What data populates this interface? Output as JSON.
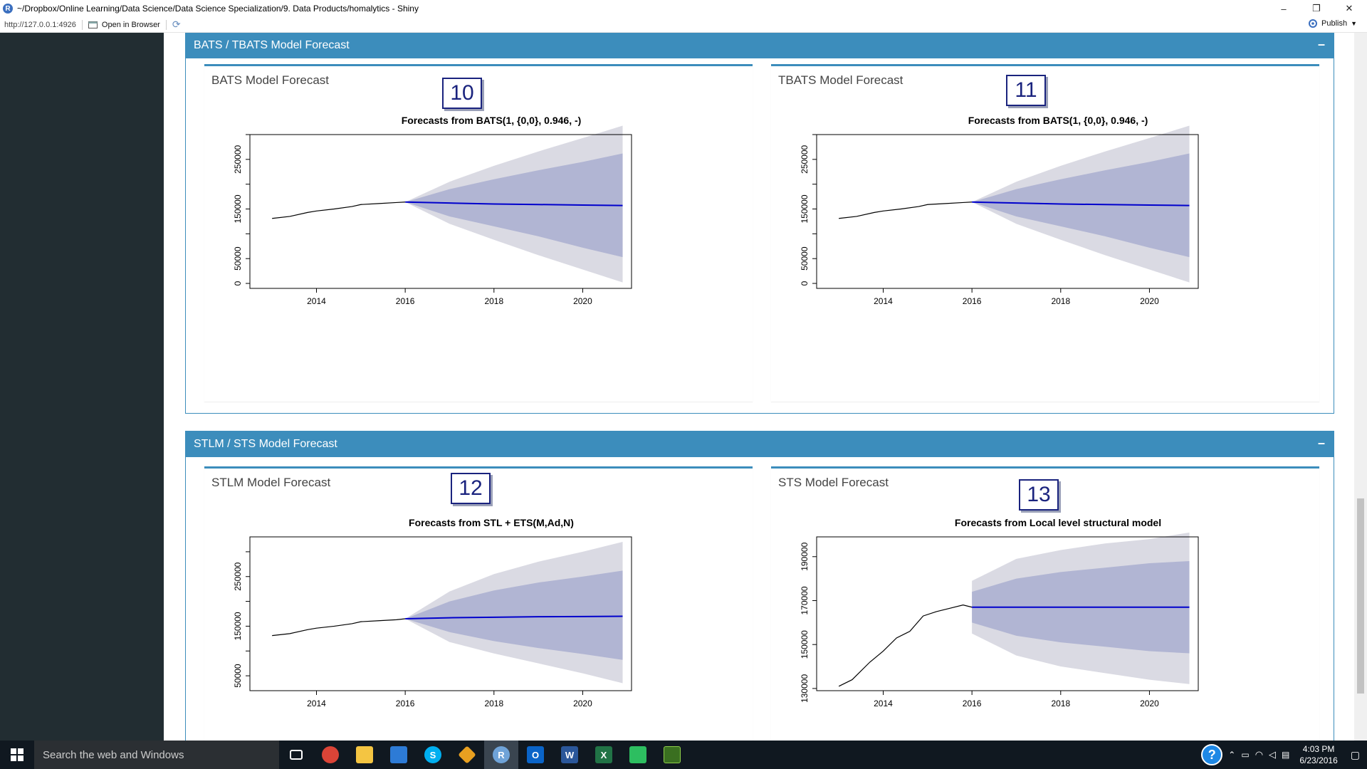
{
  "window": {
    "title": "~/Dropbox/Online Learning/Data Science/Data Science Specialization/9. Data Products/homalytics - Shiny",
    "controls": [
      "–",
      "❐",
      "✕"
    ]
  },
  "toolbar": {
    "url": "http://127.0.0.1:4926",
    "open_in_browser": "Open in Browser",
    "publish": "Publish"
  },
  "sections": [
    {
      "title": "BATS / TBATS Model Forecast",
      "collapse": "–",
      "panels": [
        {
          "title": "BATS Model Forecast",
          "badge": "10",
          "plot_title": "Forecasts from BATS(1, {0,0}, 0.946, -)"
        },
        {
          "title": "TBATS Model Forecast",
          "badge": "11",
          "plot_title": "Forecasts from BATS(1, {0,0}, 0.946, -)"
        }
      ]
    },
    {
      "title": "STLM / STS Model Forecast",
      "collapse": "–",
      "panels": [
        {
          "title": "STLM Model Forecast",
          "badge": "12",
          "plot_title": "Forecasts from STL +  ETS(M,Ad,N)"
        },
        {
          "title": "STS Model Forecast",
          "badge": "13",
          "plot_title": "Forecasts from Local level structural model"
        }
      ]
    }
  ],
  "colors": {
    "box_header": "#3c8dbc",
    "sidebar": "#222d32",
    "band80": "#b1b5d3",
    "band95": "#dadae3",
    "forecast_line": "#0000cc"
  },
  "chart_data": [
    {
      "type": "line",
      "title": "Forecasts from BATS(1, {0,0}, 0.946, -)",
      "xlabel": "",
      "ylabel": "",
      "xlim": [
        2012.5,
        2021.1
      ],
      "ylim": [
        -10000,
        300000
      ],
      "x_ticks": [
        2014,
        2016,
        2018,
        2020
      ],
      "y_ticks": [
        0,
        50000,
        100000,
        150000,
        200000,
        250000,
        300000
      ],
      "y_tick_labels": [
        "0",
        "50000",
        "",
        "150000",
        "",
        "250000",
        ""
      ],
      "history": {
        "x": [
          2013.0,
          2013.4,
          2013.8,
          2014.0,
          2014.4,
          2014.8,
          2015.0,
          2015.4,
          2015.8,
          2016.0
        ],
        "y": [
          131000,
          135000,
          143000,
          146000,
          150000,
          155000,
          159000,
          161000,
          163000,
          164000
        ]
      },
      "forecast": {
        "x": [
          2016.0,
          2017,
          2018,
          2019,
          2020,
          2020.9
        ],
        "mean": [
          164000,
          162000,
          160000,
          159000,
          158000,
          157000
        ],
        "lo80": [
          164000,
          135000,
          115000,
          95000,
          72000,
          53000
        ],
        "hi80": [
          164000,
          190000,
          210000,
          228000,
          245000,
          262000
        ],
        "lo95": [
          164000,
          120000,
          88000,
          57000,
          28000,
          2000
        ],
        "hi95": [
          164000,
          205000,
          237000,
          266000,
          293000,
          318000
        ]
      }
    },
    {
      "type": "line",
      "title": "Forecasts from BATS(1, {0,0}, 0.946, -)",
      "xlabel": "",
      "ylabel": "",
      "xlim": [
        2012.5,
        2021.1
      ],
      "ylim": [
        -10000,
        300000
      ],
      "x_ticks": [
        2014,
        2016,
        2018,
        2020
      ],
      "y_ticks": [
        0,
        50000,
        100000,
        150000,
        200000,
        250000,
        300000
      ],
      "y_tick_labels": [
        "0",
        "50000",
        "",
        "150000",
        "",
        "250000",
        ""
      ],
      "history": {
        "x": [
          2013.0,
          2013.4,
          2013.8,
          2014.0,
          2014.4,
          2014.8,
          2015.0,
          2015.4,
          2015.8,
          2016.0
        ],
        "y": [
          131000,
          135000,
          143000,
          146000,
          150000,
          155000,
          159000,
          161000,
          163000,
          164000
        ]
      },
      "forecast": {
        "x": [
          2016.0,
          2017,
          2018,
          2019,
          2020,
          2020.9
        ],
        "mean": [
          164000,
          162000,
          160000,
          159000,
          158000,
          157000
        ],
        "lo80": [
          164000,
          135000,
          115000,
          95000,
          72000,
          53000
        ],
        "hi80": [
          164000,
          190000,
          210000,
          228000,
          245000,
          262000
        ],
        "lo95": [
          164000,
          120000,
          88000,
          57000,
          28000,
          2000
        ],
        "hi95": [
          164000,
          205000,
          237000,
          266000,
          293000,
          318000
        ]
      }
    },
    {
      "type": "line",
      "title": "Forecasts from STL +  ETS(M,Ad,N)",
      "xlabel": "",
      "ylabel": "",
      "xlim": [
        2012.5,
        2021.1
      ],
      "ylim": [
        20000,
        330000
      ],
      "x_ticks": [
        2014,
        2016,
        2018,
        2020
      ],
      "y_ticks": [
        50000,
        100000,
        150000,
        200000,
        250000,
        300000
      ],
      "y_tick_labels": [
        "50000",
        "",
        "150000",
        "",
        "250000",
        ""
      ],
      "history": {
        "x": [
          2013.0,
          2013.4,
          2013.8,
          2014.0,
          2014.4,
          2014.8,
          2015.0,
          2015.4,
          2015.8,
          2016.0
        ],
        "y": [
          131000,
          135000,
          143000,
          146000,
          150000,
          155000,
          159000,
          161000,
          163000,
          165000
        ]
      },
      "forecast": {
        "x": [
          2016.0,
          2017,
          2018,
          2019,
          2020,
          2020.9
        ],
        "mean": [
          165000,
          167000,
          168000,
          169000,
          169500,
          170000
        ],
        "lo80": [
          165000,
          138000,
          120000,
          106000,
          94000,
          82000
        ],
        "hi80": [
          165000,
          200000,
          222000,
          238000,
          250000,
          262000
        ],
        "lo95": [
          165000,
          118000,
          95000,
          75000,
          55000,
          35000
        ],
        "hi95": [
          165000,
          220000,
          255000,
          280000,
          300000,
          320000
        ]
      }
    },
    {
      "type": "line",
      "title": "Forecasts from Local level structural model",
      "xlabel": "",
      "ylabel": "",
      "xlim": [
        2012.5,
        2021.1
      ],
      "ylim": [
        129000,
        199000
      ],
      "x_ticks": [
        2014,
        2016,
        2018,
        2020
      ],
      "y_ticks": [
        130000,
        150000,
        170000,
        190000
      ],
      "y_tick_labels": [
        "130000",
        "150000",
        "170000",
        "190000"
      ],
      "history": {
        "x": [
          2013.0,
          2013.3,
          2013.7,
          2014.0,
          2014.3,
          2014.6,
          2014.9,
          2015.2,
          2015.5,
          2015.8,
          2016.0
        ],
        "y": [
          131000,
          134000,
          142000,
          147000,
          153000,
          156000,
          163000,
          165000,
          166500,
          168000,
          167000
        ]
      },
      "forecast": {
        "x": [
          2016.0,
          2017,
          2018,
          2019,
          2020,
          2020.9
        ],
        "mean": [
          167000,
          167000,
          167000,
          167000,
          167000,
          167000
        ],
        "lo80": [
          160000,
          154000,
          151000,
          149000,
          147000,
          146000
        ],
        "hi80": [
          174000,
          180000,
          183000,
          185000,
          187000,
          188000
        ],
        "lo95": [
          155000,
          145000,
          140000,
          137000,
          134000,
          132000
        ],
        "hi95": [
          179000,
          189000,
          193000,
          196000,
          198000,
          201000
        ]
      }
    }
  ],
  "taskbar": {
    "search_placeholder": "Search the web and Windows",
    "time": "4:03 PM",
    "date": "6/23/2016",
    "help": "?"
  }
}
